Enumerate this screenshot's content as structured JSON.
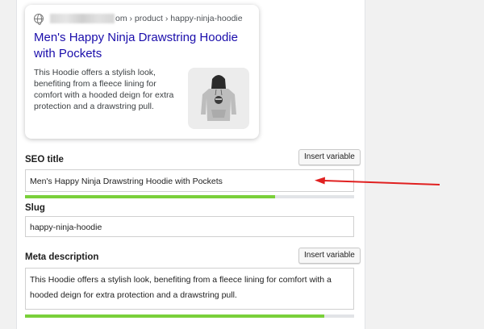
{
  "preview": {
    "breadcrumb": "om › product › happy-ninja-hoodie",
    "title": "Men's Happy Ninja Drawstring Hoodie with Pockets",
    "snippet": "This Hoodie offers a stylish look, benefiting from a fleece lining for comfort with a hooded deign for extra protection and a drawstring pull."
  },
  "seo_title": {
    "label": "SEO title",
    "insert_label": "Insert variable",
    "value": "Men's Happy Ninja Drawstring Hoodie with Pockets",
    "progress_percent": 76,
    "progress_color": "#7ad03a"
  },
  "slug": {
    "label": "Slug",
    "value": "happy-ninja-hoodie"
  },
  "meta_description": {
    "label": "Meta description",
    "insert_label": "Insert variable",
    "value": "This Hoodie offers a stylish look, benefiting from a fleece lining for comfort with a hooded deign for extra protection and a drawstring pull.",
    "progress_percent": 91,
    "progress_color": "#7ad03a"
  },
  "colors": {
    "link": "#1a0dab",
    "annotation_arrow": "#e02020"
  },
  "icons": {
    "favicon": "globe-icon",
    "thumbnail": "hoodie-image",
    "annotation": "red-arrow-icon"
  }
}
